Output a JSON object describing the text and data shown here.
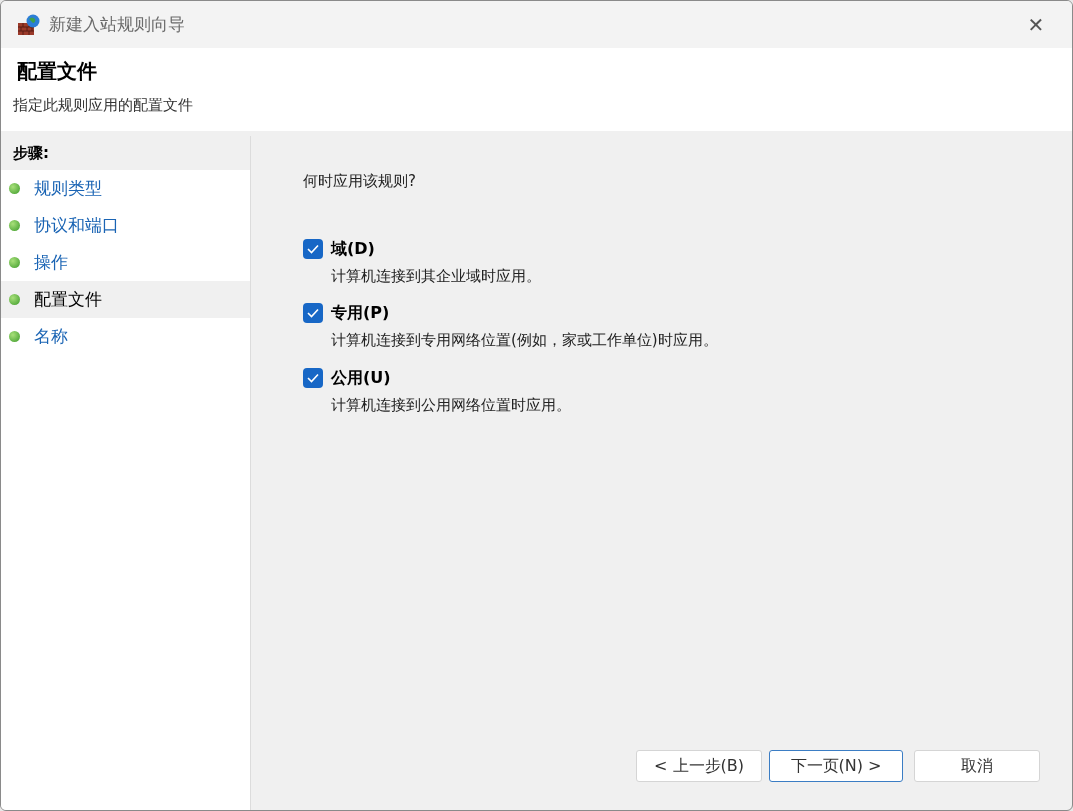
{
  "window": {
    "title": "新建入站规则向导",
    "close": "✕"
  },
  "header": {
    "title": "配置文件",
    "subtitle": "指定此规则应用的配置文件"
  },
  "steps": {
    "heading": "步骤:",
    "items": [
      {
        "label": "规则类型",
        "selected": false
      },
      {
        "label": "协议和端口",
        "selected": false
      },
      {
        "label": "操作",
        "selected": false
      },
      {
        "label": "配置文件",
        "selected": true
      },
      {
        "label": "名称",
        "selected": false
      }
    ]
  },
  "question": "何时应用该规则?",
  "profiles": [
    {
      "label": "域(D)",
      "description": "计算机连接到其企业域时应用。",
      "checked": true
    },
    {
      "label": "专用(P)",
      "description": "计算机连接到专用网络位置(例如，家或工作单位)时应用。",
      "checked": true
    },
    {
      "label": "公用(U)",
      "description": "计算机连接到公用网络位置时应用。",
      "checked": true
    }
  ],
  "buttons": [
    {
      "kind": "back",
      "label": "上一步(B)",
      "arrow": "<"
    },
    {
      "kind": "next",
      "label": "下一页(N)",
      "arrow": ">"
    },
    {
      "kind": "cancel",
      "label": "取消"
    }
  ]
}
